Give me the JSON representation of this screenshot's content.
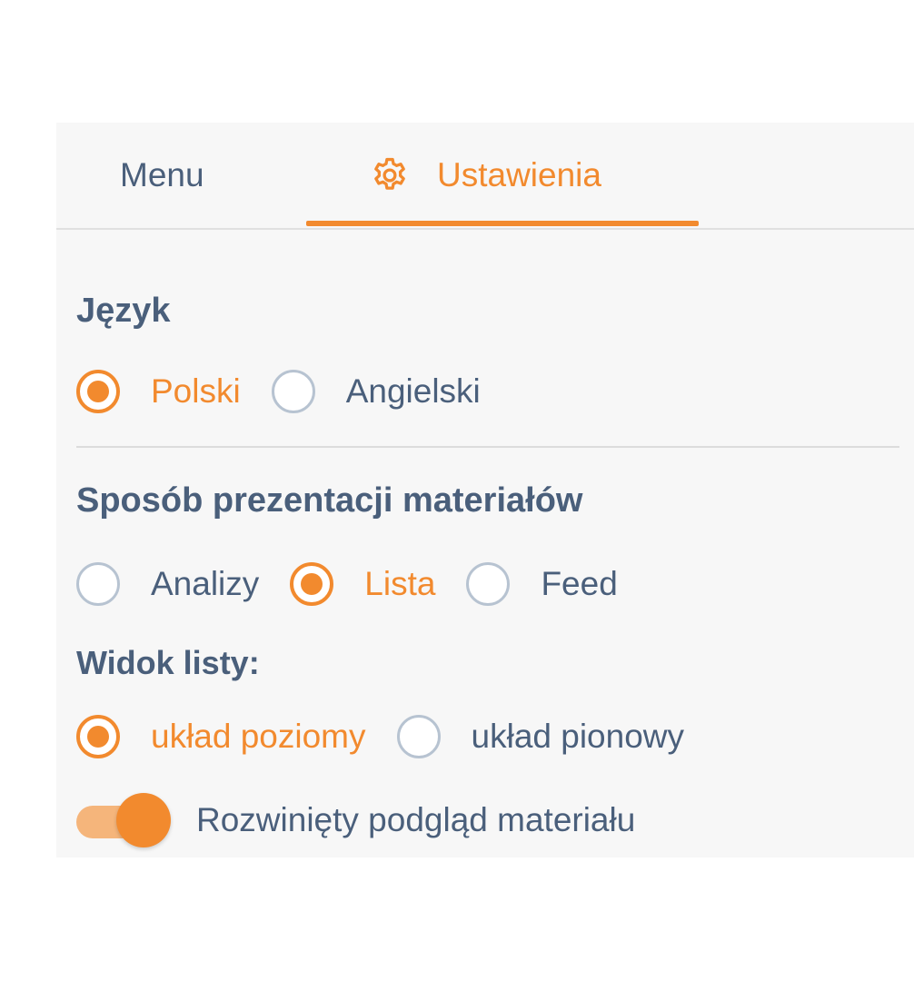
{
  "tabs": {
    "menu": "Menu",
    "settings": "Ustawienia"
  },
  "language": {
    "title": "Język",
    "options": [
      {
        "label": "Polski",
        "selected": true
      },
      {
        "label": "Angielski",
        "selected": false
      }
    ]
  },
  "presentation": {
    "title": "Sposób prezentacji materiałów",
    "options": [
      {
        "label": "Analizy",
        "selected": false
      },
      {
        "label": "Lista",
        "selected": true
      },
      {
        "label": "Feed",
        "selected": false
      }
    ]
  },
  "list_view": {
    "title": "Widok listy:",
    "options": [
      {
        "label": "układ poziomy",
        "selected": true
      },
      {
        "label": "układ pionowy",
        "selected": false
      }
    ]
  },
  "expanded_preview": {
    "label": "Rozwinięty podgląd materiału",
    "enabled": true
  },
  "colors": {
    "accent": "#f28a2e",
    "text": "#4a5f7b",
    "radio_border": "#b7c3d1",
    "panel_bg": "#f7f7f7"
  },
  "icons": {
    "settings_tab": "gear-icon"
  }
}
